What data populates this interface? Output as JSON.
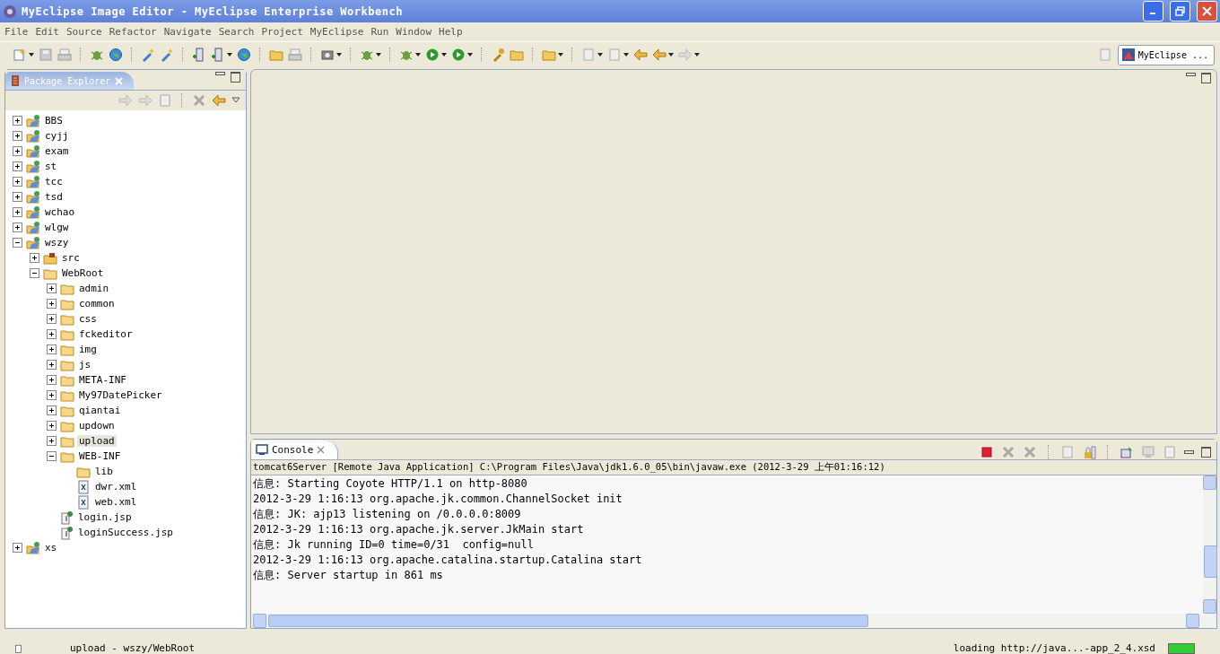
{
  "window": {
    "title": "MyEclipse Image Editor - MyEclipse Enterprise Workbench"
  },
  "menu": [
    "File",
    "Edit",
    "Source",
    "Refactor",
    "Navigate",
    "Search",
    "Project",
    "MyEclipse",
    "Run",
    "Window",
    "Help"
  ],
  "perspective": {
    "label": "MyEclipse ..."
  },
  "package_explorer": {
    "title": "Package Explorer",
    "tree": [
      {
        "label": "BBS",
        "kind": "project",
        "expanded": false,
        "selected": false
      },
      {
        "label": "cyjj",
        "kind": "project",
        "expanded": false,
        "selected": false
      },
      {
        "label": "exam",
        "kind": "project",
        "expanded": false,
        "selected": false
      },
      {
        "label": "st",
        "kind": "project",
        "expanded": false,
        "selected": false
      },
      {
        "label": "tcc",
        "kind": "project",
        "expanded": false,
        "selected": false
      },
      {
        "label": "tsd",
        "kind": "project",
        "expanded": false,
        "selected": false
      },
      {
        "label": "wchao",
        "kind": "project",
        "expanded": false,
        "selected": false
      },
      {
        "label": "wlgw",
        "kind": "project",
        "expanded": false,
        "selected": false
      },
      {
        "label": "wszy",
        "kind": "project",
        "expanded": true,
        "selected": false,
        "children": [
          {
            "label": "src",
            "kind": "source",
            "expanded": false,
            "selected": false
          },
          {
            "label": "WebRoot",
            "kind": "folder",
            "expanded": true,
            "selected": false,
            "children": [
              {
                "label": "admin",
                "kind": "folder",
                "expanded": false,
                "selected": false
              },
              {
                "label": "common",
                "kind": "folder",
                "expanded": false,
                "selected": false
              },
              {
                "label": "css",
                "kind": "folder",
                "expanded": false,
                "selected": false
              },
              {
                "label": "fckeditor",
                "kind": "folder",
                "expanded": false,
                "selected": false
              },
              {
                "label": "img",
                "kind": "folder",
                "expanded": false,
                "selected": false
              },
              {
                "label": "js",
                "kind": "folder",
                "expanded": false,
                "selected": false
              },
              {
                "label": "META-INF",
                "kind": "folder",
                "expanded": false,
                "selected": false
              },
              {
                "label": "My97DatePicker",
                "kind": "folder",
                "expanded": false,
                "selected": false
              },
              {
                "label": "qiantai",
                "kind": "folder",
                "expanded": false,
                "selected": false
              },
              {
                "label": "updown",
                "kind": "folder",
                "expanded": false,
                "selected": false
              },
              {
                "label": "upload",
                "kind": "folder",
                "expanded": false,
                "selected": true
              },
              {
                "label": "WEB-INF",
                "kind": "folder",
                "expanded": true,
                "selected": false,
                "children": [
                  {
                    "label": "lib",
                    "kind": "folder",
                    "selected": false
                  },
                  {
                    "label": "dwr.xml",
                    "kind": "xml",
                    "selected": false
                  },
                  {
                    "label": "web.xml",
                    "kind": "xml",
                    "selected": false
                  }
                ]
              },
              {
                "label": "login.jsp",
                "kind": "jsp",
                "selected": false
              },
              {
                "label": "loginSuccess.jsp",
                "kind": "jsp",
                "selected": false
              }
            ]
          }
        ]
      },
      {
        "label": "xs",
        "kind": "project",
        "expanded": false,
        "selected": false
      }
    ]
  },
  "console": {
    "title": "Console",
    "process": "tomcat6Server [Remote Java Application] C:\\Program Files\\Java\\jdk1.6.0_05\\bin\\javaw.exe (2012-3-29 上午01:16:12)",
    "lines": [
      "信息: Starting Coyote HTTP/1.1 on http-8080",
      "2012-3-29 1:16:13 org.apache.jk.common.ChannelSocket init",
      "信息: JK: ajp13 listening on /0.0.0.0:8009",
      "2012-3-29 1:16:13 org.apache.jk.server.JkMain start",
      "信息: Jk running ID=0 time=0/31  config=null",
      "2012-3-29 1:16:13 org.apache.catalina.startup.Catalina start",
      "信息: Server startup in 861 ms"
    ]
  },
  "status_bar": {
    "selection": "upload - wszy/WebRoot",
    "message": "loading http://java...-app_2_4.xsd"
  }
}
